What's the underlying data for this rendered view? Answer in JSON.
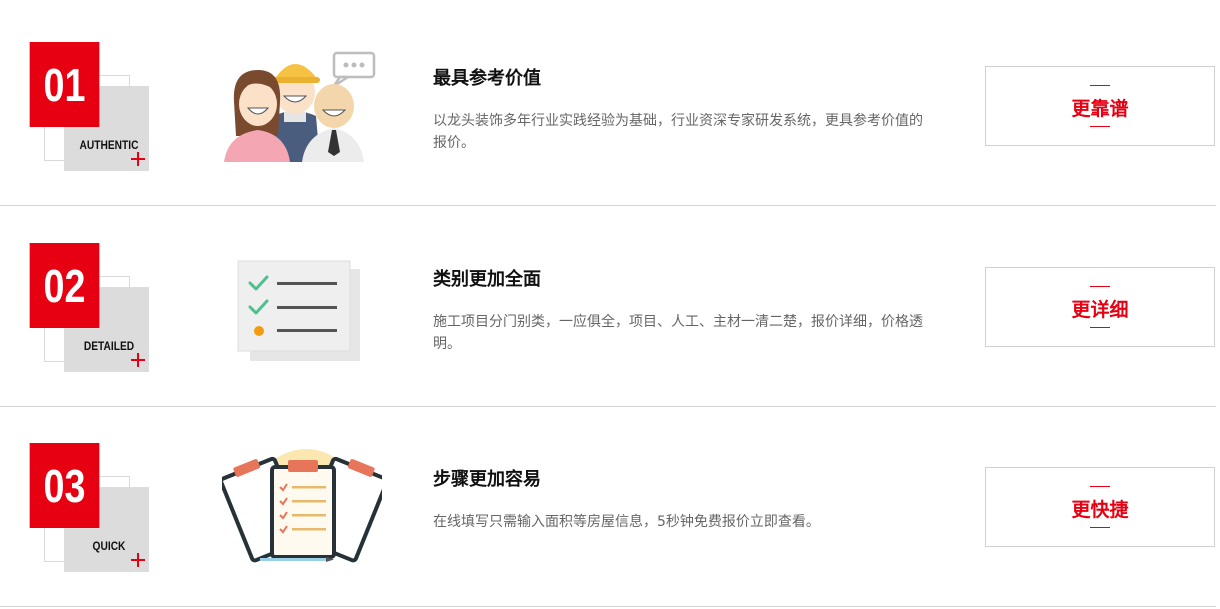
{
  "features": [
    {
      "number": "01",
      "badge_word": "AUTHENTIC",
      "icon": "people-team-icon",
      "title": "最具参考价值",
      "description": "以龙头装饰多年行业实践经验为基础，行业资深专家研发系统，更具参考价值的报价。",
      "tag": "更靠谱"
    },
    {
      "number": "02",
      "badge_word": "DETAILED",
      "icon": "checklist-icon",
      "title": "类别更加全面",
      "description": "施工项目分门别类，一应俱全，项目、人工、主材一清二楚，报价详细，价格透明。",
      "tag": "更详细"
    },
    {
      "number": "03",
      "badge_word": "QUICK",
      "icon": "clipboards-icon",
      "title": "步骤更加容易",
      "description": "在线填写只需输入面积等房屋信息，5秒钟免费报价立即查看。",
      "tag": "更快捷"
    }
  ],
  "colors": {
    "brand_red": "#e60012",
    "badge_gray": "#dcdcdc",
    "divider": "#d4d4d4",
    "text_dark": "#111111",
    "text_gray": "#666666"
  }
}
